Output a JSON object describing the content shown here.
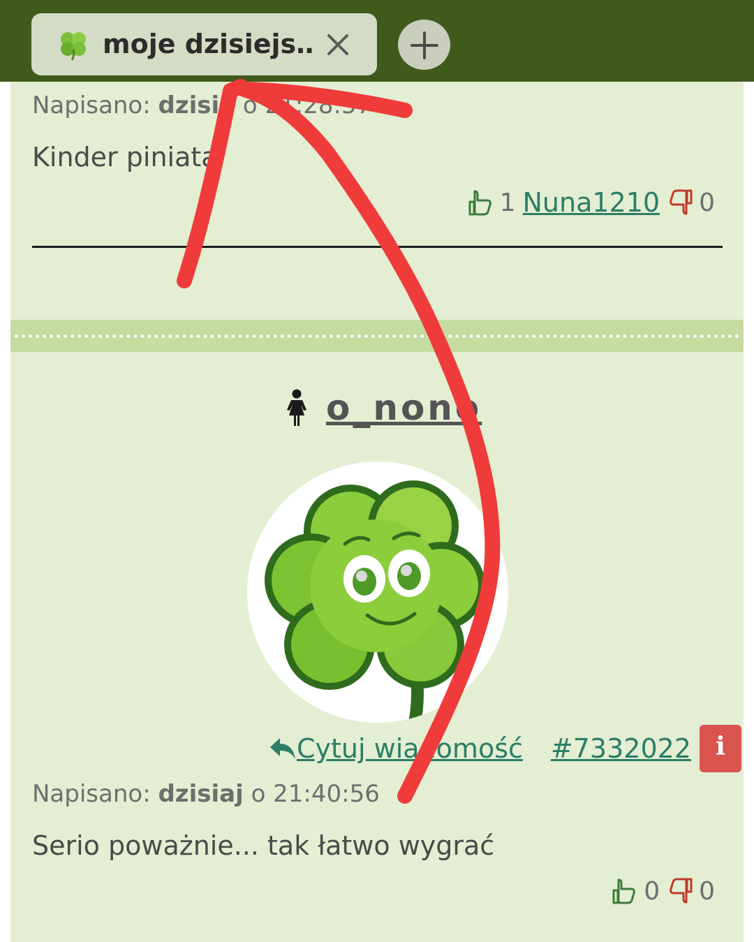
{
  "browser": {
    "tab": {
      "title": "moje dzisiejs…",
      "favicon": "clover-icon",
      "close_icon": "close-icon"
    },
    "new_tab_icon": "plus-icon",
    "colors": {
      "toolbar": "#3f5a1b",
      "tab": "#d5dcc5"
    }
  },
  "post1": {
    "meta_label": "Napisano:",
    "meta_author": "dzisia",
    "meta_time": "o 21:28:57",
    "text": "Kinder piniata",
    "likes": "1",
    "liker": "Nuna1210",
    "dislikes": "0"
  },
  "post2": {
    "author_icon": "female-user-icon",
    "author": "o_nono",
    "avatar": "clover-mascot",
    "quote_label": "Cytuj wiadomość",
    "post_id": "#7332022",
    "info_icon": "info-icon",
    "meta_label": "Napisano:",
    "meta_author": "dzisiaj",
    "meta_time": "o 21:40:56",
    "text": "Serio poważnie... tak łatwo wygrać",
    "likes": "0",
    "dislikes": "0"
  },
  "colors": {
    "page_bg": "#e3eed3",
    "separator": "#c5db9f",
    "link": "#2b7d67",
    "info_button": "#d9534f",
    "annotation_stroke": "#f03b3b"
  }
}
